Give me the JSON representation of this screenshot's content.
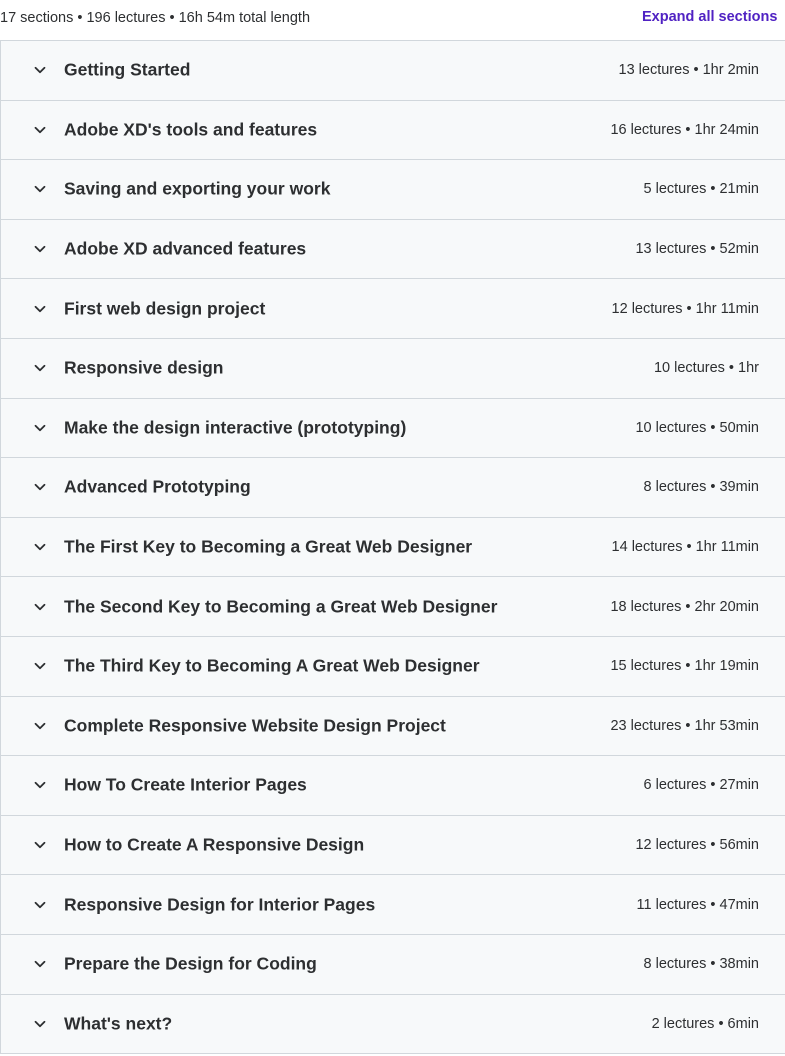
{
  "curriculum": {
    "summary": "17 sections • 196 lectures • 16h 54m total length",
    "expand_all_label": "Expand all sections",
    "sections": [
      {
        "title": "Getting Started",
        "meta": "13 lectures • 1hr 2min"
      },
      {
        "title": "Adobe XD's tools and features",
        "meta": "16 lectures • 1hr 24min"
      },
      {
        "title": "Saving and exporting your work",
        "meta": "5 lectures • 21min"
      },
      {
        "title": "Adobe XD advanced features",
        "meta": "13 lectures • 52min"
      },
      {
        "title": "First web design project",
        "meta": "12 lectures • 1hr 11min"
      },
      {
        "title": "Responsive design",
        "meta": "10 lectures • 1hr"
      },
      {
        "title": "Make the design interactive (prototyping)",
        "meta": "10 lectures • 50min"
      },
      {
        "title": "Advanced Prototyping",
        "meta": "8 lectures • 39min"
      },
      {
        "title": "The First Key to Becoming a Great Web Designer",
        "meta": "14 lectures • 1hr 11min"
      },
      {
        "title": "The Second Key to Becoming a Great Web Designer",
        "meta": "18 lectures • 2hr 20min"
      },
      {
        "title": "The Third Key to Becoming A Great Web Designer",
        "meta": "15 lectures • 1hr 19min"
      },
      {
        "title": "Complete Responsive Website Design Project",
        "meta": "23 lectures • 1hr 53min"
      },
      {
        "title": "How To Create Interior Pages",
        "meta": "6 lectures • 27min"
      },
      {
        "title": "How to Create A Responsive Design",
        "meta": "12 lectures • 56min"
      },
      {
        "title": "Responsive Design for Interior Pages",
        "meta": "11 lectures • 47min"
      },
      {
        "title": "Prepare the Design for Coding",
        "meta": "8 lectures • 38min"
      },
      {
        "title": "What's next?",
        "meta": "2 lectures • 6min"
      }
    ]
  },
  "icons": {
    "section_toggle": "chevron-down-icon"
  },
  "colors": {
    "accent": "#5022c3",
    "row_background": "#f7f9fa",
    "border": "#d1d7dc",
    "text": "#2d2f31"
  }
}
